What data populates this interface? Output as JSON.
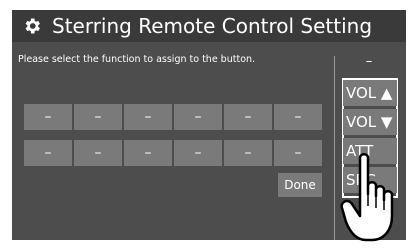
{
  "title": "Sterring Remote Control Setting",
  "instruction": "Please select the function to assign to the button.",
  "slots": {
    "row1": [
      "–",
      "–",
      "–",
      "–",
      "–",
      "–"
    ],
    "row2": [
      "–",
      "–",
      "–",
      "–",
      "–",
      "–"
    ]
  },
  "done_label": "Done",
  "function_list": {
    "header_dash": "–",
    "items": [
      "VOL ▲",
      "VOL ▼",
      "ATT",
      "SRC"
    ]
  },
  "icons": {
    "settings": "gear-icon",
    "pointer": "hand-pointer-icon"
  },
  "colors": {
    "background": "#4d4d4d",
    "title_bar": "#3a3a3a",
    "button": "#7a7a7a",
    "text": "#ffffff"
  }
}
